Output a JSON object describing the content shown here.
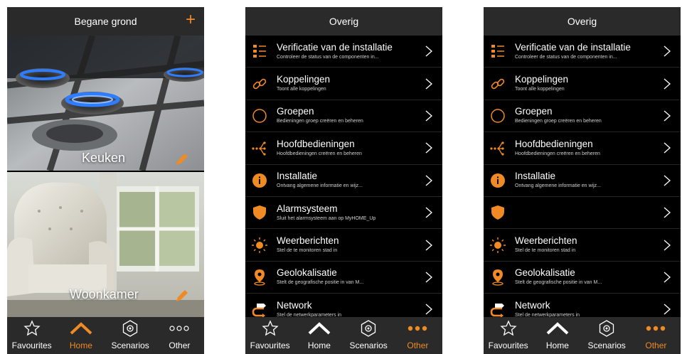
{
  "accent": "#f08a24",
  "phone1": {
    "title": "Begane grond",
    "add_icon": "plus-icon",
    "rooms": [
      {
        "name": "Keuken"
      },
      {
        "name": "Woonkamer"
      }
    ],
    "tabs": [
      {
        "label": "Favourites",
        "icon": "star-icon"
      },
      {
        "label": "Home",
        "icon": "home-icon",
        "active": true
      },
      {
        "label": "Scenarios",
        "icon": "scenario-icon"
      },
      {
        "label": "Other",
        "icon": "more-icon"
      }
    ]
  },
  "phone2": {
    "title": "Overig",
    "items": [
      {
        "title": "Verificatie van de installatie",
        "sub": "Controleer de status van de componenten in...",
        "icon": "checklist-icon"
      },
      {
        "title": "Koppelingen",
        "sub": "Toont alle koppelingen",
        "icon": "link-icon"
      },
      {
        "title": "Groepen",
        "sub": "Bedieningen groep creëren en beheren",
        "icon": "circle-icon"
      },
      {
        "title": "Hoofdbedieningen",
        "sub": "Hoofdbedieningen creëren en beheren",
        "icon": "master-control-icon"
      },
      {
        "title": "Installatie",
        "sub": "Ontvang algemene informatie en wijz...",
        "icon": "info-icon"
      },
      {
        "title": "Alarmsysteem",
        "sub": "Sluit het alarmsysteem aan op MyHOME_Up",
        "icon": "shield-icon"
      },
      {
        "title": "Weerberichten",
        "sub": "Stel de te monitoren stad in",
        "icon": "sun-icon"
      },
      {
        "title": "Geolokalisatie",
        "sub": "Stelt de geografische positie in van M...",
        "icon": "location-pin-icon"
      },
      {
        "title": "Network",
        "sub": "Stel de netwerkparameters in",
        "icon": "network-icon"
      }
    ],
    "tabs": [
      {
        "label": "Favourites",
        "icon": "star-icon"
      },
      {
        "label": "Home",
        "icon": "home-icon"
      },
      {
        "label": "Scenarios",
        "icon": "scenario-icon"
      },
      {
        "label": "Other",
        "icon": "more-icon",
        "active": true
      }
    ]
  },
  "phone3": {
    "title": "Overig",
    "items": [
      {
        "title": "Verificatie van de installatie",
        "sub": "Controleer de status van de componenten in...",
        "icon": "checklist-icon"
      },
      {
        "title": "Koppelingen",
        "sub": "Toont alle koppelingen",
        "icon": "link-icon"
      },
      {
        "title": "Groepen",
        "sub": "Bedieningen groep creëren en beheren",
        "icon": "circle-icon"
      },
      {
        "title": "Hoofdbedieningen",
        "sub": "Hoofdbedieningen creëren en beheren",
        "icon": "master-control-icon"
      },
      {
        "title": "Installatie",
        "sub": "Ontvang algemene informatie en wijz...",
        "icon": "info-icon"
      },
      {
        "title": "",
        "sub": "",
        "icon": "shield-icon"
      },
      {
        "title": "Weerberichten",
        "sub": "Stel de te monitoren stad in",
        "icon": "sun-icon"
      },
      {
        "title": "Geolokalisatie",
        "sub": "Stelt de geografische positie in van M...",
        "icon": "location-pin-icon"
      },
      {
        "title": "Network",
        "sub": "Stel de netwerkparameters in",
        "icon": "network-icon"
      }
    ],
    "tabs": [
      {
        "label": "Favourites",
        "icon": "star-icon"
      },
      {
        "label": "Home",
        "icon": "home-icon"
      },
      {
        "label": "Scenarios",
        "icon": "scenario-icon"
      },
      {
        "label": "Other",
        "icon": "more-icon",
        "active": true
      }
    ]
  }
}
